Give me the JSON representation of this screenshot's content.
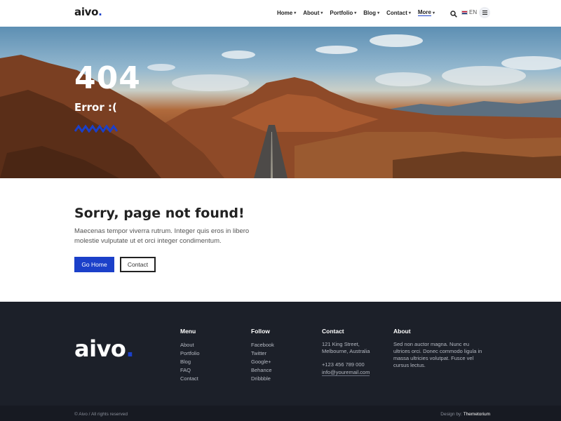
{
  "header": {
    "logo_text": "aivo",
    "logo_dot": ".",
    "nav": [
      {
        "label": "Home"
      },
      {
        "label": "About"
      },
      {
        "label": "Portfolio"
      },
      {
        "label": "Blog"
      },
      {
        "label": "Contact"
      },
      {
        "label": "More"
      }
    ],
    "lang": "EN"
  },
  "hero": {
    "code": "404",
    "subtitle": "Error :("
  },
  "main": {
    "title": "Sorry, page not found!",
    "text": "Maecenas tempor viverra rutrum. Integer quis eros in libero molestie vulputate ut et orci integer condimentum.",
    "home_button": "Go Home",
    "contact_button": "Contact"
  },
  "footer": {
    "logo_text": "aivo",
    "logo_dot": ".",
    "menu": {
      "title": "Menu",
      "items": [
        "About",
        "Portfolio",
        "Blog",
        "FAQ",
        "Contact"
      ]
    },
    "follow": {
      "title": "Follow",
      "items": [
        "Facebook",
        "Twitter",
        "Google+",
        "Behance",
        "Dribbble"
      ]
    },
    "contact": {
      "title": "Contact",
      "address1": "121 King Street,",
      "address2": "Melbourne, Australia",
      "phone": "+123 456 789 000",
      "email": "info@youremail.com"
    },
    "about": {
      "title": "About",
      "text": "Sed non auctor magna. Nunc eu ultrices orci. Donec commodo ligula in massa ultricies volutpat. Fusce vel cursus lectus."
    },
    "copyright": "© Aivo / All rights reserved",
    "design_label": "Design by:",
    "design_by": "Themetorium"
  },
  "colors": {
    "accent": "#1b40c9",
    "footer_bg": "#1c2029"
  }
}
